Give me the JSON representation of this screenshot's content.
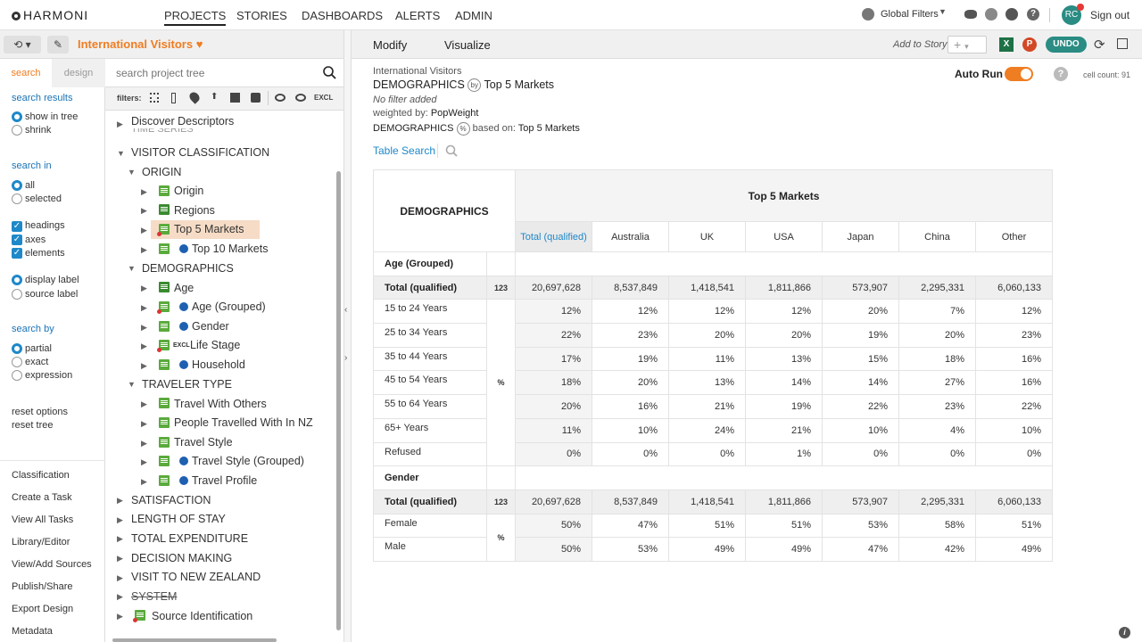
{
  "app": {
    "logo": "HARMONI"
  },
  "nav": [
    "PROJECTS",
    "STORIES",
    "DASHBOARDS",
    "ALERTS",
    "ADMIN"
  ],
  "topright": {
    "global_filters": "Global Filters",
    "avatar": "RC",
    "signout": "Sign out"
  },
  "project": {
    "title": "International Visitors"
  },
  "left": {
    "tabs": [
      "search",
      "design"
    ],
    "search_results": "search results",
    "show_in_tree": "show in tree",
    "shrink": "shrink",
    "search_in": "search in",
    "all": "all",
    "selected": "selected",
    "headings": "headings",
    "axes": "axes",
    "elements": "elements",
    "display_label": "display label",
    "source_label": "source label",
    "search_by": "search by",
    "partial": "partial",
    "exact": "exact",
    "expression": "expression",
    "reset_options": "reset options",
    "reset_tree": "reset tree",
    "links": [
      "Classification",
      "Create a Task",
      "View All Tasks",
      "Library/Editor",
      "View/Add Sources",
      "Publish/Share",
      "Export Design",
      "Metadata"
    ]
  },
  "tree": {
    "search_placeholder": "search project tree",
    "filters_label": "filters:",
    "excl": "EXCL",
    "items": [
      {
        "label": "Discover Descriptors"
      },
      {
        "label": "TIME SERIES"
      },
      {
        "label": "VISITOR CLASSIFICATION"
      },
      {
        "label": "ORIGIN"
      },
      {
        "label": "Origin"
      },
      {
        "label": "Regions"
      },
      {
        "label": "Top 5 Markets"
      },
      {
        "label": "Top 10 Markets"
      },
      {
        "label": "DEMOGRAPHICS"
      },
      {
        "label": "Age"
      },
      {
        "label": "Age (Grouped)"
      },
      {
        "label": "Gender"
      },
      {
        "label": "Life Stage"
      },
      {
        "label": "Household"
      },
      {
        "label": "TRAVELER TYPE"
      },
      {
        "label": "Travel With Others"
      },
      {
        "label": "People Travelled With In NZ"
      },
      {
        "label": "Travel Style"
      },
      {
        "label": "Travel Style (Grouped)"
      },
      {
        "label": "Travel Profile"
      },
      {
        "label": "SATISFACTION"
      },
      {
        "label": "LENGTH OF STAY"
      },
      {
        "label": "TOTAL EXPENDITURE"
      },
      {
        "label": "DECISION MAKING"
      },
      {
        "label": "VISIT TO NEW ZEALAND"
      },
      {
        "label": "SYSTEM"
      },
      {
        "label": "Source Identification"
      }
    ]
  },
  "main": {
    "tabs": [
      "Modify",
      "Visualize"
    ],
    "add_to_story": "Add to Story",
    "undo": "UNDO",
    "auto_run": "Auto Run",
    "cell_count": "cell count: 91",
    "breadcrumb": "International Visitors",
    "heading_row": "DEMOGRAPHICS",
    "heading_by": "Top 5 Markets",
    "no_filter": "No filter added",
    "weighted_label": "weighted by:",
    "weighted_value": "PopWeight",
    "based_on_left": "DEMOGRAPHICS",
    "based_on_label": "based on:",
    "based_on_value": "Top 5 Markets",
    "table_search": "Table Search"
  },
  "table": {
    "row_header": "DEMOGRAPHICS",
    "col_header": "Top 5 Markets",
    "columns": [
      "Total (qualified)",
      "Australia",
      "UK",
      "USA",
      "Japan",
      "China",
      "Other"
    ],
    "sections": [
      {
        "title": "Age (Grouped)",
        "total_label": "Total (qualified)",
        "total_badge": "123",
        "total": [
          "20,697,628",
          "8,537,849",
          "1,418,541",
          "1,811,866",
          "573,907",
          "2,295,331",
          "6,060,133"
        ],
        "unit": "%",
        "rows": [
          {
            "label": "15 to 24 Years",
            "values": [
              "12%",
              "12%",
              "12%",
              "12%",
              "20%",
              "7%",
              "12%"
            ]
          },
          {
            "label": "25 to 34 Years",
            "values": [
              "22%",
              "23%",
              "20%",
              "20%",
              "19%",
              "20%",
              "23%"
            ]
          },
          {
            "label": "35 to 44 Years",
            "values": [
              "17%",
              "19%",
              "11%",
              "13%",
              "15%",
              "18%",
              "16%"
            ]
          },
          {
            "label": "45 to 54 Years",
            "values": [
              "18%",
              "20%",
              "13%",
              "14%",
              "14%",
              "27%",
              "16%"
            ]
          },
          {
            "label": "55 to 64 Years",
            "values": [
              "20%",
              "16%",
              "21%",
              "19%",
              "22%",
              "23%",
              "22%"
            ]
          },
          {
            "label": "65+ Years",
            "values": [
              "11%",
              "10%",
              "24%",
              "21%",
              "10%",
              "4%",
              "10%"
            ]
          },
          {
            "label": "Refused",
            "values": [
              "0%",
              "0%",
              "0%",
              "1%",
              "0%",
              "0%",
              "0%"
            ]
          }
        ]
      },
      {
        "title": "Gender",
        "total_label": "Total (qualified)",
        "total_badge": "123",
        "total": [
          "20,697,628",
          "8,537,849",
          "1,418,541",
          "1,811,866",
          "573,907",
          "2,295,331",
          "6,060,133"
        ],
        "unit": "%",
        "rows": [
          {
            "label": "Female",
            "values": [
              "50%",
              "47%",
              "51%",
              "51%",
              "53%",
              "58%",
              "51%"
            ]
          },
          {
            "label": "Male",
            "values": [
              "50%",
              "53%",
              "49%",
              "49%",
              "47%",
              "42%",
              "49%"
            ]
          }
        ]
      }
    ]
  }
}
